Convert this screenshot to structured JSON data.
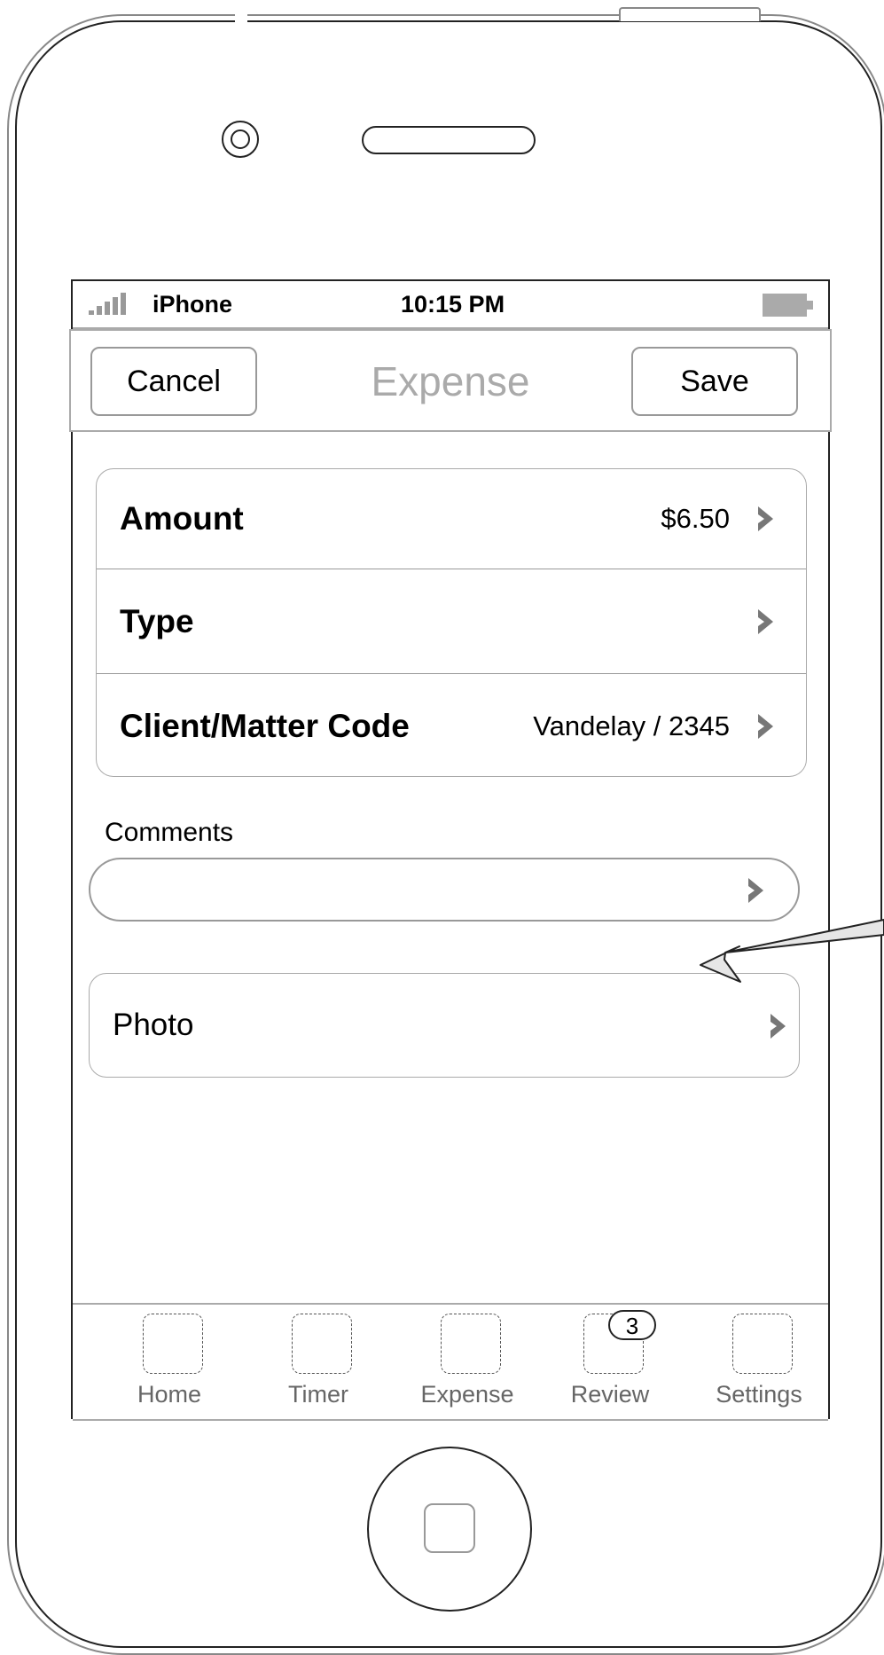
{
  "statusbar": {
    "carrier": "iPhone",
    "time": "10:15 PM"
  },
  "navbar": {
    "cancel_label": "Cancel",
    "title": "Expense",
    "save_label": "Save"
  },
  "form": {
    "rows": [
      {
        "label": "Amount",
        "value": "$6.50"
      },
      {
        "label": "Type",
        "value": ""
      },
      {
        "label": "Client/Matter Code",
        "value": "Vandelay / 2345"
      }
    ],
    "comments_label": "Comments",
    "comments_value": "",
    "photo_label": "Photo"
  },
  "tabbar": {
    "tabs": [
      {
        "label": "Home",
        "badge": ""
      },
      {
        "label": "Timer",
        "badge": ""
      },
      {
        "label": "Expense",
        "badge": ""
      },
      {
        "label": "Review",
        "badge": "3"
      },
      {
        "label": "Settings",
        "badge": ""
      }
    ]
  },
  "icons": {
    "chevron": "chevron-right-icon",
    "tab_placeholder": "placeholder-icon",
    "signal": "signal-strength-icon",
    "battery": "battery-icon"
  },
  "colors": {
    "chevron": "#777777",
    "title": "#aaaaaa",
    "border": "#aaaaaa"
  }
}
